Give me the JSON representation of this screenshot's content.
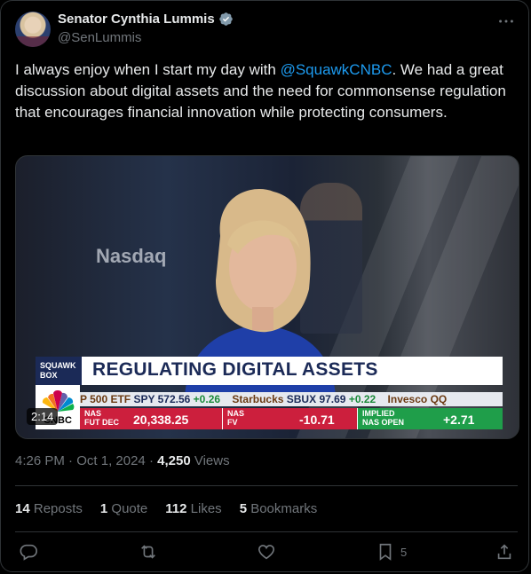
{
  "author": {
    "name": "Senator Cynthia Lummis",
    "handle": "@SenLummis",
    "verified_icon": "verified-badge-icon"
  },
  "tweet": {
    "text_before": "I always enjoy when I start my day with ",
    "mention": "@SquawkCNBC",
    "text_after": ". We had a great discussion about digital assets and the need for commonsense regulation that encourages financial innovation while protecting consumers."
  },
  "video": {
    "background_sign": "Nasdaq",
    "show_label": "SQUAWK BOX",
    "headline": "REGULATING DIGITAL ASSETS",
    "ticker": [
      {
        "name": "P 500 ETF",
        "symbol": "SPY",
        "price": "572.56",
        "change": "+0.26"
      },
      {
        "name": "Starbucks",
        "symbol": "SBUX",
        "price": "97.69",
        "change": "+0.22"
      },
      {
        "name": "Invesco QQ",
        "symbol": "",
        "price": "",
        "change": ""
      }
    ],
    "market_strip": [
      {
        "label_line1": "NAS",
        "label_line2": "FUT",
        "label_extra": "DEC",
        "value": "20,338.25",
        "color": "#cc1f3d"
      },
      {
        "label_line1": "NAS",
        "label_line2": "FV",
        "label_extra": "",
        "value": "-10.71",
        "color": "#cc1f3d"
      },
      {
        "label_line1": "IMPLIED",
        "label_line2": "NAS OPEN",
        "label_extra": "",
        "value": "+2.71",
        "color": "#1f9e4a"
      }
    ],
    "network_logo": "CNBC",
    "duration": "2:14"
  },
  "meta": {
    "time": "4:26 PM",
    "separator": "·",
    "date": "Oct 1, 2024",
    "views_count": "4,250",
    "views_label": "Views"
  },
  "stats": {
    "reposts_count": "14",
    "reposts_label": "Reposts",
    "quotes_count": "1",
    "quotes_label": "Quote",
    "likes_count": "112",
    "likes_label": "Likes",
    "bookmarks_count": "5",
    "bookmarks_label": "Bookmarks"
  },
  "actions": {
    "bookmark_count": "5"
  },
  "colors": {
    "accent": "#1d9bf0",
    "muted": "#71767b",
    "text": "#e7e9ea",
    "border": "#2f3336"
  }
}
